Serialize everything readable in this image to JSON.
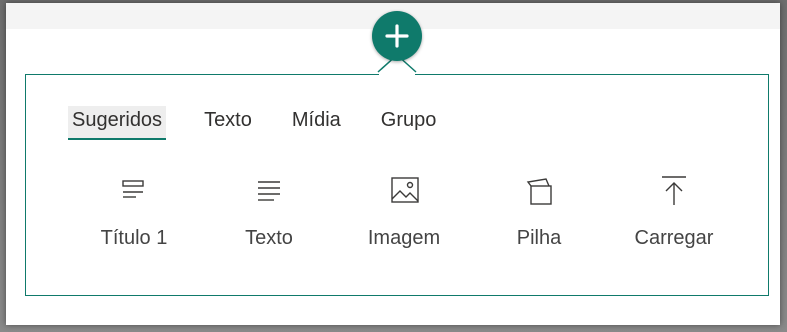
{
  "accent": "#0f7a6b",
  "add_button": {
    "icon": "plus-icon"
  },
  "tabs": [
    {
      "label": "Sugeridos",
      "active": true
    },
    {
      "label": "Texto"
    },
    {
      "label": "Mídia"
    },
    {
      "label": "Grupo"
    }
  ],
  "items": [
    {
      "label": "Título 1",
      "icon": "heading-icon"
    },
    {
      "label": "Texto",
      "icon": "text-icon"
    },
    {
      "label": "Imagem",
      "icon": "image-icon"
    },
    {
      "label": "Pilha",
      "icon": "stack-icon"
    },
    {
      "label": "Carregar",
      "icon": "upload-icon"
    }
  ]
}
